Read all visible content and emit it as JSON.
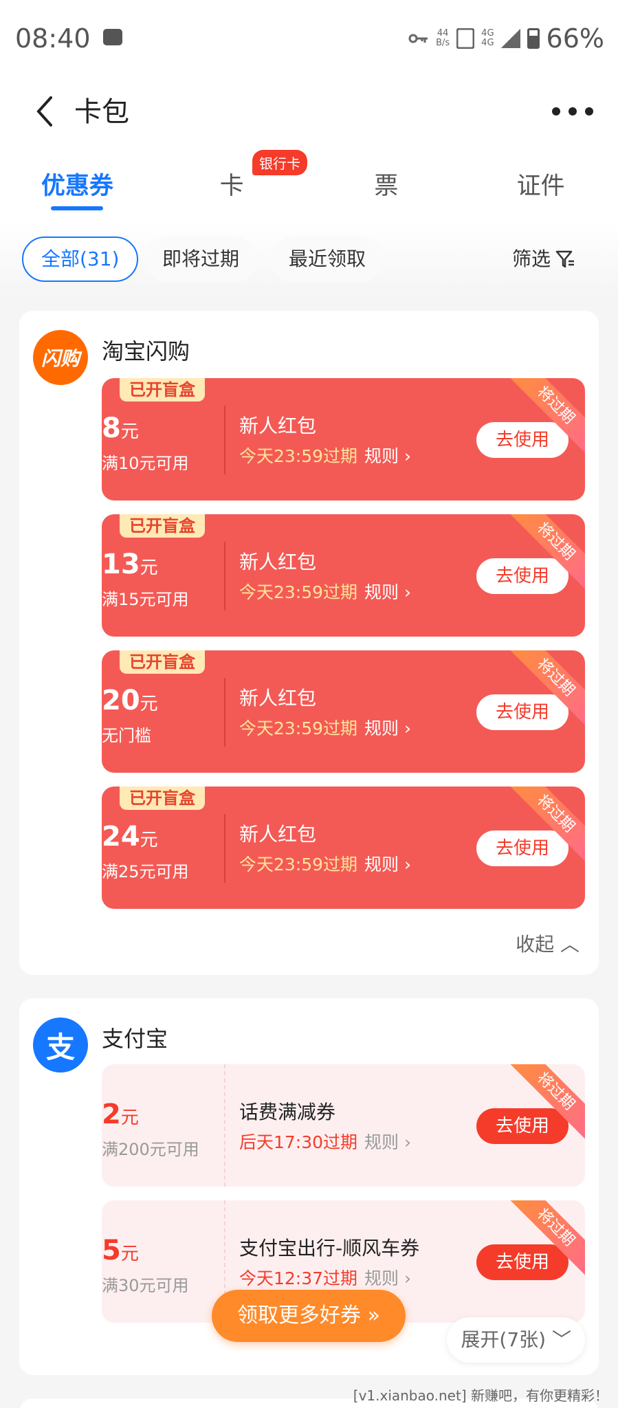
{
  "status_bar": {
    "time": "08:40",
    "net_speed_value": "44",
    "net_speed_unit": "B/s",
    "network": "4G",
    "network2": "4G",
    "battery": "66%"
  },
  "header": {
    "title": "卡包"
  },
  "tabs": [
    {
      "label": "优惠券",
      "active": true
    },
    {
      "label": "卡",
      "badge": "银行卡"
    },
    {
      "label": "票"
    },
    {
      "label": "证件"
    }
  ],
  "filters": {
    "chips": [
      "全部(31)",
      "即将过期",
      "最近领取"
    ],
    "filter_label": "筛选"
  },
  "groups": [
    {
      "brand": "淘宝闪购",
      "logo_text": "闪购",
      "logo_color": "#ff6a00",
      "coupons": [
        {
          "tag": "已开盲盒",
          "amount": "8",
          "unit": "元",
          "condition": "满10元可用",
          "name": "新人红包",
          "expire": "今天23:59过期",
          "rule": "规则",
          "button": "去使用",
          "ribbon": "将过期"
        },
        {
          "tag": "已开盲盒",
          "amount": "13",
          "unit": "元",
          "condition": "满15元可用",
          "name": "新人红包",
          "expire": "今天23:59过期",
          "rule": "规则",
          "button": "去使用",
          "ribbon": "将过期"
        },
        {
          "tag": "已开盲盒",
          "amount": "20",
          "unit": "元",
          "condition": "无门槛",
          "name": "新人红包",
          "expire": "今天23:59过期",
          "rule": "规则",
          "button": "去使用",
          "ribbon": "将过期"
        },
        {
          "tag": "已开盲盒",
          "amount": "24",
          "unit": "元",
          "condition": "满25元可用",
          "name": "新人红包",
          "expire": "今天23:59过期",
          "rule": "规则",
          "button": "去使用",
          "ribbon": "将过期"
        }
      ],
      "collapse_label": "收起"
    },
    {
      "brand": "支付宝",
      "logo_text": "支",
      "logo_color": "#1677ff",
      "coupons": [
        {
          "amount": "2",
          "unit": "元",
          "condition": "满200元可用",
          "name": "话费满减券",
          "expire": "后天17:30过期",
          "rule": "规则",
          "button": "去使用",
          "ribbon": "将过期"
        },
        {
          "amount": "5",
          "unit": "元",
          "condition": "满30元可用",
          "name": "支付宝出行-顺风车券",
          "expire": "今天12:37过期",
          "rule": "规则",
          "button": "去使用",
          "ribbon": "将过期"
        }
      ],
      "expand_label": "展开(7张)"
    }
  ],
  "fab_label": "领取更多好券",
  "footer": "[v1.xianbao.net] 新赚吧，有你更精彩！",
  "colors": {
    "accent": "#1677ff",
    "coupon_red": "#f45a55",
    "button_red": "#f53b2a",
    "orange": "#ff8a2a"
  }
}
